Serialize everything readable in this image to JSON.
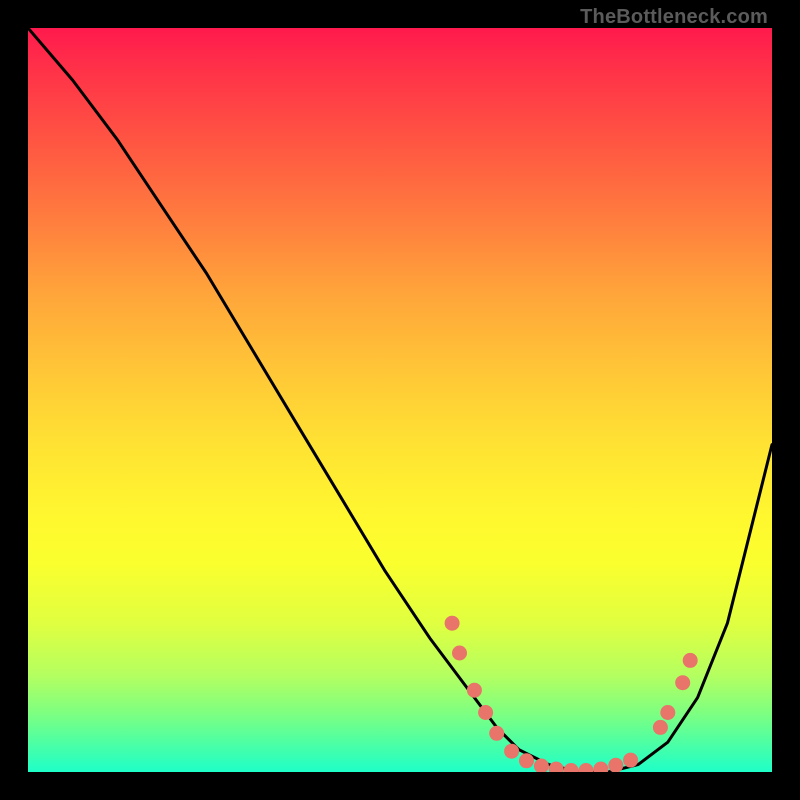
{
  "attribution": "TheBottleneck.com",
  "chart_data": {
    "type": "line",
    "title": "",
    "xlabel": "",
    "ylabel": "",
    "xlim": [
      0,
      100
    ],
    "ylim": [
      0,
      100
    ],
    "series": [
      {
        "name": "bottleneck-curve",
        "x": [
          0,
          6,
          12,
          18,
          24,
          30,
          36,
          42,
          48,
          54,
          60,
          63,
          66,
          70,
          74,
          78,
          82,
          86,
          90,
          94,
          100
        ],
        "y": [
          100,
          93,
          85,
          76,
          67,
          57,
          47,
          37,
          27,
          18,
          10,
          6,
          3,
          1,
          0,
          0,
          1,
          4,
          10,
          20,
          44
        ],
        "color": "#000000"
      }
    ],
    "markers": [
      {
        "x": 57.0,
        "y": 20.0
      },
      {
        "x": 58.0,
        "y": 16.0
      },
      {
        "x": 60.0,
        "y": 11.0
      },
      {
        "x": 61.5,
        "y": 8.0
      },
      {
        "x": 63.0,
        "y": 5.2
      },
      {
        "x": 65.0,
        "y": 2.8
      },
      {
        "x": 67.0,
        "y": 1.5
      },
      {
        "x": 69.0,
        "y": 0.8
      },
      {
        "x": 71.0,
        "y": 0.4
      },
      {
        "x": 73.0,
        "y": 0.2
      },
      {
        "x": 75.0,
        "y": 0.2
      },
      {
        "x": 77.0,
        "y": 0.4
      },
      {
        "x": 79.0,
        "y": 0.9
      },
      {
        "x": 81.0,
        "y": 1.6
      },
      {
        "x": 85.0,
        "y": 6.0
      },
      {
        "x": 86.0,
        "y": 8.0
      },
      {
        "x": 88.0,
        "y": 12.0
      },
      {
        "x": 89.0,
        "y": 15.0
      }
    ],
    "marker_color": "#e8746a"
  }
}
